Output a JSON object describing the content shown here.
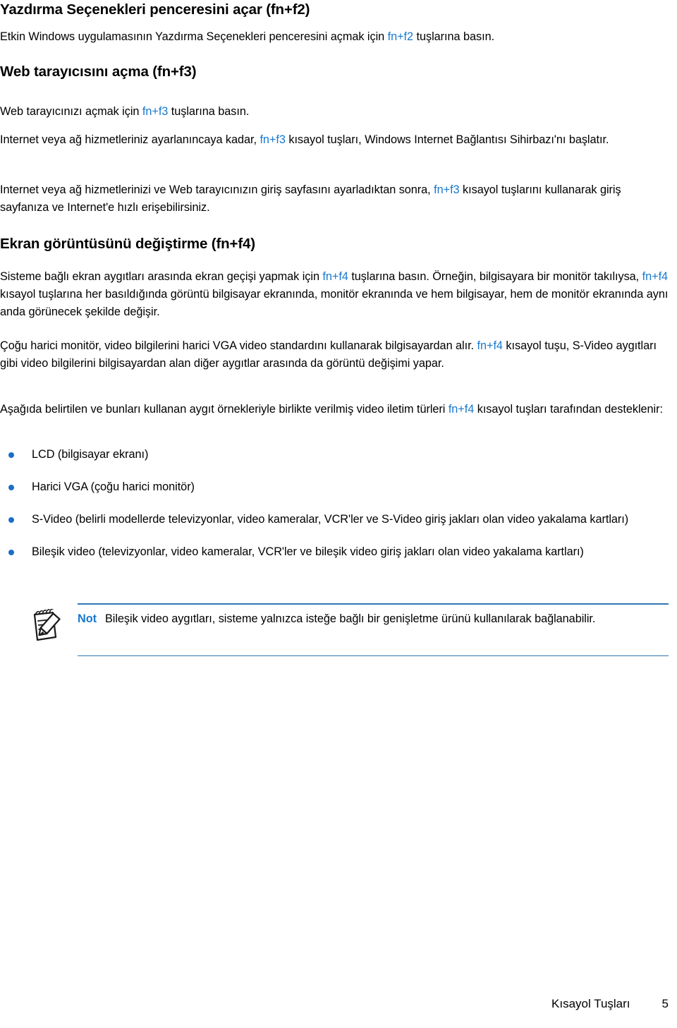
{
  "document": {
    "title": "Kısayol Tuşları",
    "page_number": "5",
    "accent_blue": "#1878cf",
    "rule_blue": "#2f76b3",
    "bullet_blue": "#1a6fc4"
  },
  "sections": [
    {
      "heading": "Yazdırma Seçenekleri penceresini açar (fn+f2)",
      "paragraph_pre": "Etkin Windows uygulamasının Yazdırma Seçenekleri penceresini açmak için ",
      "key": "fn+f2",
      "paragraph_post": " tuşlarına basın."
    },
    {
      "heading": "Web tarayıcısını açma (fn+f3)",
      "p1_pre": "Web tarayıcınızı açmak için ",
      "p1_key": "fn+f3",
      "p1_post": " tuşlarına basın.",
      "p2_pre": "Internet veya ağ hizmetleriniz ayarlanıncaya kadar, ",
      "p2_key": "fn+f3",
      "p2_post": " kısayol tuşları, Windows Internet Bağlantısı Sihirbazı'nı başlatır.",
      "p3_pre": "Internet veya ağ hizmetlerinizi ve Web tarayıcınızın giriş sayfasını ayarladıktan sonra, ",
      "p3_key": "fn+f3",
      "p3_post": " kısayol tuşlarını kullanarak giriş sayfanıza ve Internet'e hızlı erişebilirsiniz."
    },
    {
      "heading": "Ekran görüntüsünü değiştirme (fn+f4)",
      "p1_a": "Sisteme bağlı ekran aygıtları arasında ekran geçişi yapmak için ",
      "p1_key1": "fn+f4",
      "p1_b": " tuşlarına basın. Örneğin, bilgisayara bir monitör takılıysa, ",
      "p1_key2": "fn+f4",
      "p1_c": " kısayol tuşlarına her basıldığında görüntü bilgisayar ekranında, monitör ekranında ve hem bilgisayar, hem de monitör ekranında aynı anda görünecek şekilde değişir.",
      "p2_a": "Çoğu harici monitör, video bilgilerini harici VGA video standardını kullanarak bilgisayardan alır. ",
      "p2_key": "fn+f4",
      "p2_b": " kısayol tuşu, S-Video aygıtları gibi video bilgilerini bilgisayardan alan diğer aygıtlar arasında da görüntü değişimi yapar.",
      "p3_a": "Aşağıda belirtilen ve bunları kullanan aygıt örnekleriyle birlikte verilmiş video iletim türleri ",
      "p3_key": "fn+f4",
      "p3_b": " kısayol tuşları tarafından desteklenir:"
    }
  ],
  "bullets": [
    "LCD (bilgisayar ekranı)",
    "Harici VGA (çoğu harici monitör)",
    "S-Video (belirli modellerde televizyonlar, video kameralar, VCR'ler ve S-Video giriş jakları olan video yakalama kartları)",
    "Bileşik video (televizyonlar, video kameralar, VCR'ler ve bileşik video giriş jakları olan video yakalama kartları)"
  ],
  "note": {
    "icon": "notepad-pencil-icon",
    "label": "Not",
    "text": "Bileşik video aygıtları, sisteme yalnızca isteğe bağlı bir genişletme ürünü kullanılarak bağlanabilir."
  }
}
